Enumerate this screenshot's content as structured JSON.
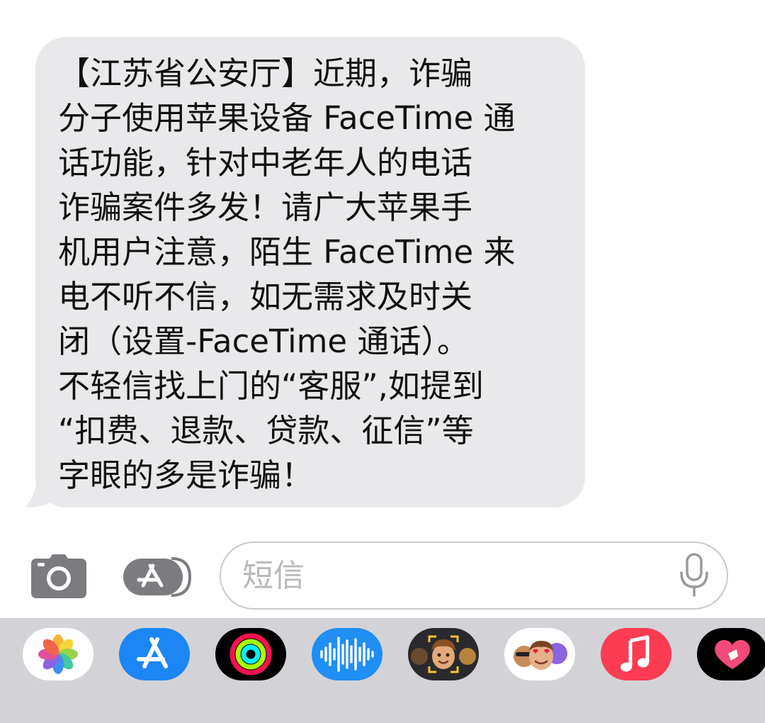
{
  "message": {
    "lines": [
      "【江苏省公安厅】近期，诈骗",
      "分子使用苹果设备 FaceTime 通",
      "话功能，针对中老年人的电话",
      "诈骗案件多发！请广大苹果手",
      "机用户注意，陌生 FaceTime 来",
      "电不听不信，如无需求及时关",
      "闭（设置-FaceTime 通话）。",
      "不轻信找上门的“客服”,如提到",
      "“扣费、退款、贷款、征信”等",
      "字眼的多是诈骗！"
    ],
    "bubble_color": "#e9e9eb"
  },
  "compose": {
    "placeholder": "短信",
    "value": "",
    "icons": {
      "camera": "camera-icon",
      "apps": "app-store-icon",
      "mic": "microphone-icon"
    }
  },
  "app_drawer": {
    "apps": [
      {
        "id": "photos",
        "icon": "photos-icon"
      },
      {
        "id": "app-store",
        "icon": "app-store-icon",
        "color": "#1b86f4"
      },
      {
        "id": "activity",
        "icon": "activity-rings-icon",
        "color": "#000000"
      },
      {
        "id": "audio-message",
        "icon": "audio-waveform-icon",
        "color": "#1f8ef5"
      },
      {
        "id": "memoji",
        "icon": "memoji-icon"
      },
      {
        "id": "memoji-stickers",
        "icon": "memoji-stickers-icon"
      },
      {
        "id": "music",
        "icon": "music-note-icon",
        "color": "#fb3c53"
      },
      {
        "id": "digital-touch",
        "icon": "digital-touch-heart-icon",
        "color": "#000000"
      }
    ],
    "background": "#d3d3d7"
  }
}
